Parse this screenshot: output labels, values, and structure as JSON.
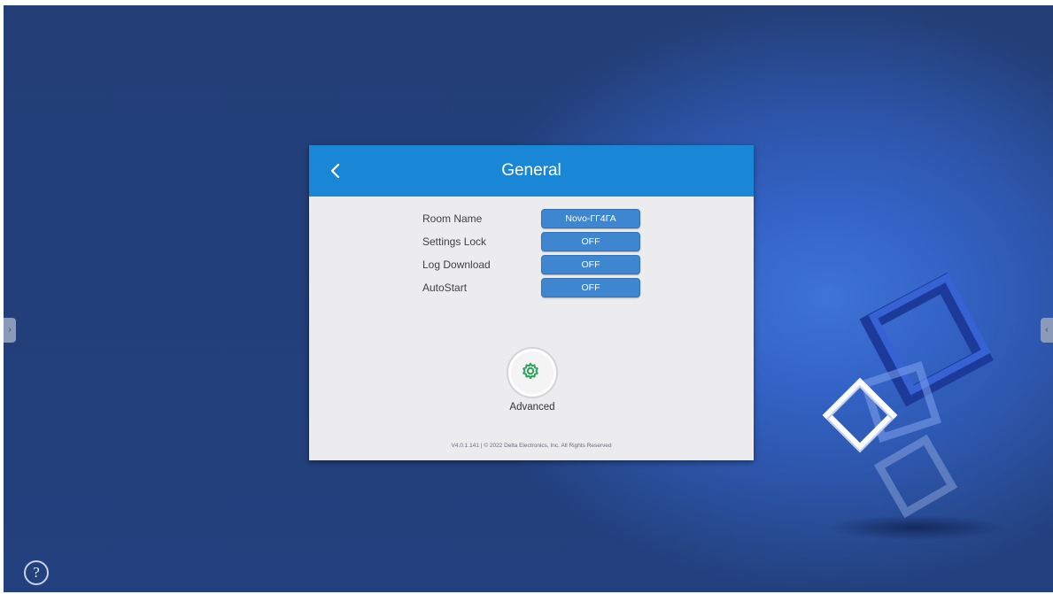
{
  "dialog": {
    "title": "General",
    "back_icon": "chevron-left-icon"
  },
  "settings": [
    {
      "label": "Room Name",
      "value": "Novo-ГГ4ГА"
    },
    {
      "label": "Settings Lock",
      "value": "OFF"
    },
    {
      "label": "Log Download",
      "value": "OFF"
    },
    {
      "label": "AutoStart",
      "value": "OFF"
    }
  ],
  "advanced": {
    "label": "Advanced",
    "icon": "gear-icon",
    "icon_color": "#2aa55a"
  },
  "footer": {
    "version_text": "V4.0.1.141 | © 2022 Delta Electronics, Inc. All Rights Reserved"
  },
  "help": {
    "glyph": "?",
    "icon": "help-icon"
  },
  "colors": {
    "header": "#1a86d6",
    "button": "#3f86d0",
    "background": "#233f7a"
  }
}
